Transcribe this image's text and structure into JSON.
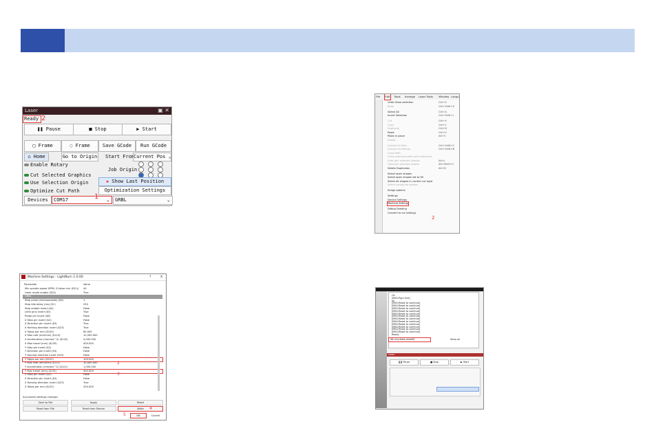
{
  "laser_panel": {
    "window_title": "Laser",
    "status": "Ready",
    "marker_status": "2",
    "pause": "Pause",
    "stop": "Stop",
    "start": "Start",
    "frame1": "Frame",
    "frame2": "Frame",
    "save_gcode": "Save GCode",
    "run_gcode": "Run GCode",
    "home": "Home",
    "go_to_origin": "Go to Origin",
    "start_from": "Start From:",
    "start_from_value": "Current Pos",
    "enable_rotary": "Enable Rotary",
    "job_origin": "Job Origin",
    "cut_selected": "Cut Selected Graphics",
    "use_selection_origin": "Use Selection Origin",
    "show_last_position": "Show Last Position",
    "optimize_cut_path": "Optimize Cut Path",
    "optimization_settings": "Optimization Settings",
    "devices": "Devices",
    "port_value": "COM17",
    "marker_port": "1",
    "device_value": "GRBL"
  },
  "machine_settings": {
    "title": "Machine Settings - LightBurn 1.0.00",
    "help": "?",
    "close": "X",
    "col_param": "Parameter",
    "col_value": "Value",
    "rows": [
      {
        "k": "Min spindle speed (RPM, S-Value min ($31))",
        "v": "40"
      },
      {
        "k": "Laser mode enable ($32)",
        "v": "True"
      },
      {
        "k": "GRBL",
        "v": ""
      },
      {
        "k": "Step pulse (microseconds) ($0)",
        "v": "1"
      },
      {
        "k": "Step idle delay (ms) ($1)",
        "v": "250"
      },
      {
        "k": "Step enable invert ($4)",
        "v": "False"
      },
      {
        "k": "Limit pins invert ($5)",
        "v": "True"
      },
      {
        "k": "Probe pin invert ($6)",
        "v": "False"
      },
      {
        "k": "X Step pin invert ($2)",
        "v": "False"
      },
      {
        "k": "X Direction pin invert ($3)",
        "v": "True"
      },
      {
        "k": "X Homing direction invert ($23)",
        "v": "True"
      },
      {
        "k": "X Steps per mm ($100)",
        "v": "80.000"
      },
      {
        "k": "X Max rate (mm/min) ($110)",
        "v": "10,000.000"
      },
      {
        "k": "X Acceleration (mm/sec^2) ($120)",
        "v": "4,000.000"
      },
      {
        "k": "X Max travel (mm) ($130)",
        "v": "400.000"
      },
      {
        "k": "Y Step pin invert ($2)",
        "v": "False"
      },
      {
        "k": "Y Direction pin invert ($3)",
        "v": "False"
      },
      {
        "k": "Y Homing direction invert ($23)",
        "v": "False"
      },
      {
        "k": "Y Steps per mm ($101)",
        "v": "100.000"
      },
      {
        "k": "Y Max rate (mm/min) ($111)",
        "v": "10,000.000"
      },
      {
        "k": "Y Acceleration (mm/sec^2) ($121)",
        "v": "1,000.000"
      },
      {
        "k": "Y Max travel (mm) ($131)",
        "v": "400.000"
      },
      {
        "k": "Z Step pin invert ($2)",
        "v": "False"
      },
      {
        "k": "Z Direction pin invert ($3)",
        "v": "False"
      },
      {
        "k": "Z Homing direction invert ($23)",
        "v": "True"
      },
      {
        "k": "Z Steps per mm ($102)",
        "v": "250.000"
      }
    ],
    "status_line": "Successful settings changes",
    "save_to_file": "Save to File",
    "apply": "Apply",
    "reset": "Reset",
    "read_from_file": "Read from File",
    "read_from_device": "Read from Device",
    "write": "Write",
    "ok": "OK",
    "cancel": "Cancel",
    "marker_2": "2",
    "marker_3": "3",
    "marker_4": "4",
    "marker_5": "5"
  },
  "edit_menu": {
    "menubar": [
      "File",
      "Edit",
      "Tools",
      "Arrange",
      "Laser Tools",
      "Window",
      "Language"
    ],
    "items": [
      {
        "label": "Undo Show selection",
        "sc": "Ctrl+Z",
        "dis": false
      },
      {
        "label": "Redo",
        "sc": "Ctrl+Shift+Z",
        "dis": true
      },
      {
        "label": "Select All",
        "sc": "Ctrl+A",
        "dis": false
      },
      {
        "label": "Invert Selection",
        "sc": "Ctrl+Shift+I",
        "dis": false
      },
      {
        "label": "Cut",
        "sc": "Ctrl+X",
        "dis": true
      },
      {
        "label": "Copy",
        "sc": "Ctrl+C",
        "dis": true
      },
      {
        "label": "Duplicate",
        "sc": "Ctrl+D",
        "dis": true
      },
      {
        "label": "Paste",
        "sc": "Ctrl+V",
        "dis": false
      },
      {
        "label": "Paste in place",
        "sc": "Alt+V",
        "dis": false
      },
      {
        "label": "Delete",
        "sc": "",
        "dis": true
      },
      {
        "label": "Convert to Path",
        "sc": "Ctrl+Shift+C",
        "dis": true
      },
      {
        "label": "Convert to Bitmap",
        "sc": "Ctrl+Shift+B",
        "dis": true
      },
      {
        "label": "Close Path",
        "sc": "",
        "dis": true
      },
      {
        "label": "Close selected paths with tolerance",
        "sc": "",
        "dis": true
      },
      {
        "label": "Auto-Join selected shapes",
        "sc": "Alt+J",
        "dis": true
      },
      {
        "label": "Optimize selected shapes",
        "sc": "Alt+Shift+O",
        "dis": true
      },
      {
        "label": "Delete Duplicates",
        "sc": "Alt+D",
        "dis": false
      },
      {
        "label": "Select open shapes",
        "sc": "",
        "dis": false
      },
      {
        "label": "Select open shapes set to fill",
        "sc": "",
        "dis": false
      },
      {
        "label": "Select all shapes in current cut layer",
        "sc": "",
        "dis": false
      },
      {
        "label": "Select contained shapes",
        "sc": "",
        "dis": true
      },
      {
        "label": "Image options",
        "sc": "",
        "dis": false
      },
      {
        "label": "Settings",
        "sc": "",
        "dis": false
      },
      {
        "label": "Device Settings",
        "sc": "",
        "dis": false
      },
      {
        "label": "Machine Settings",
        "sc": "",
        "dis": false
      },
      {
        "label": "Debug Drawing",
        "sc": "",
        "dis": false
      },
      {
        "label": "Convert to cut (debug)",
        "sc": "",
        "dis": false
      }
    ],
    "marker": "2"
  },
  "console": {
    "title": "Console",
    "lines": [
      "Ok",
      "[MSG:Pgm End]",
      "ok",
      "[MSG:Reset to continue]",
      "[MSG:Reset to continue]",
      "[MSG:Reset to continue]",
      "[MSG:Reset to continue]",
      "[MSG:Reset to continue]",
      "[MSG:Reset to continue]",
      "[MSG:Reset to continue]",
      "[MSG:Reset to continue]",
      "[MSG:Reset to continue]",
      "[MSG:Reset to continue]",
      "[MSG:Reset to continue]",
      "[MSG:Reset to continue]",
      "Ready"
    ],
    "command_value": "$$=ms,stats,resetAll",
    "show_all": "Show all",
    "laser_label": "Laser",
    "pause": "Pause",
    "stop": "Stop",
    "start": "Start"
  }
}
